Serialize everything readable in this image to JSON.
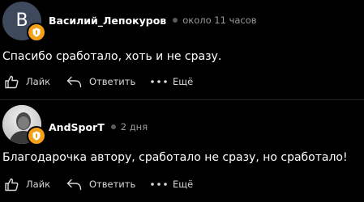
{
  "comments": [
    {
      "avatar_letter": "B",
      "author": "Василий_Лепокуров",
      "time": "около 11 часов",
      "text": "Спасибо сработало, хоть и не сразу.",
      "actions": {
        "like": "Лайк",
        "reply": "Ответить",
        "more": "Ещё"
      }
    },
    {
      "author": "AndSporT",
      "time": "2 дня",
      "text": "Благодарочка автору, сработало не сразу, но сработало!",
      "actions": {
        "like": "Лайк",
        "reply": "Ответить",
        "more": "Ещё"
      }
    }
  ],
  "colors": {
    "background": "#000000",
    "badge": "#f4a118",
    "avatar_bg": "#3e4a5c",
    "meta_text": "#9a9a9a"
  },
  "icons": [
    "badge-icon",
    "like-icon",
    "reply-icon",
    "more-icon"
  ]
}
